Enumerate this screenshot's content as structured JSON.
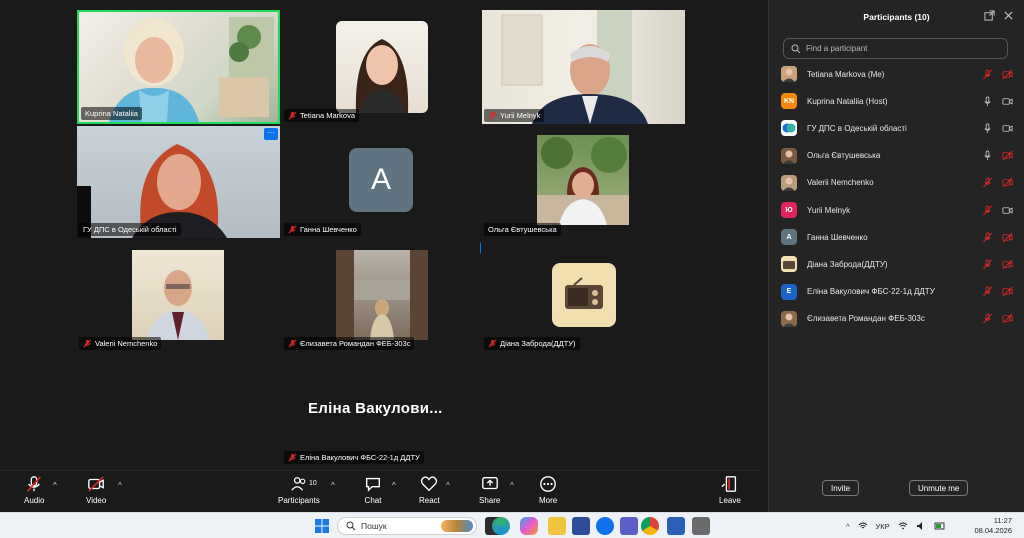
{
  "gallery": {
    "tiles": [
      {
        "name": "Kuprina Nataliia",
        "mic_muted": false
      },
      {
        "name": "Tetiana Markova",
        "mic_muted": true
      },
      {
        "name": "Yurii Melnyk",
        "mic_muted": true
      },
      {
        "name": "ГУ ДПС в Одеській області",
        "mic_muted": false
      },
      {
        "name": "Ганна Шевченко",
        "mic_muted": true,
        "initial": "A"
      },
      {
        "name": "Ольга Євтушевська",
        "mic_muted": false
      },
      {
        "name": "Valerii Nemchenko",
        "mic_muted": true
      },
      {
        "name": "Єлизавета Романдан ФЕБ-303с",
        "mic_muted": true
      },
      {
        "name": "Діана Заброда(ДДТУ)",
        "mic_muted": true
      }
    ],
    "active_speaker_display": "Еліна  Вакулови...",
    "active_speaker_tag": "Еліна Вакулович  ФБС-22-1д ДДТУ",
    "more_label": "···"
  },
  "toolbar": {
    "audio": "Audio",
    "video": "Video",
    "participants": "Participants",
    "participants_count": "10",
    "chat": "Chat",
    "react": "React",
    "share": "Share",
    "more": "More",
    "leave": "Leave"
  },
  "panel": {
    "title": "Participants (10)",
    "search_placeholder": "Find a participant",
    "participants": [
      {
        "name": "Tetiana Markova (Me)",
        "avatar": "photo",
        "color": "#c9a27c",
        "mic": "muted",
        "video": "off"
      },
      {
        "name": "Kuprina Nataliia (Host)",
        "avatar": "KN",
        "color": "#f5870a",
        "mic": "on",
        "video": "on"
      },
      {
        "name": "ГУ ДПС в Одеській області",
        "avatar": "logo",
        "color": "#1d6fd8",
        "mic": "on",
        "video": "on"
      },
      {
        "name": "Ольга Євтушевська",
        "avatar": "photo",
        "color": "#7a5a3e",
        "mic": "on",
        "video": "off"
      },
      {
        "name": "Valerii Nemchenko",
        "avatar": "photo",
        "color": "#b99c7c",
        "mic": "muted",
        "video": "off"
      },
      {
        "name": "Yurii Melnyk",
        "avatar": "Ю",
        "color": "#e0245e",
        "mic": "muted",
        "video": "on"
      },
      {
        "name": "Ганна Шевченко",
        "avatar": "A",
        "color": "#5f7480",
        "mic": "muted",
        "video": "off"
      },
      {
        "name": "Діана Заброда(ДДТУ)",
        "avatar": "radio",
        "color": "#f1dfb0",
        "mic": "muted",
        "video": "off"
      },
      {
        "name": "Еліна Вакулович  ФБС-22-1д ДДТУ",
        "avatar": "E",
        "color": "#1a63c7",
        "mic": "muted",
        "video": "off"
      },
      {
        "name": "Єлизавета Романдан ФЕБ-303с",
        "avatar": "photo",
        "color": "#8b6a4b",
        "mic": "muted",
        "video": "off"
      }
    ],
    "invite_label": "Invite",
    "unmute_label": "Unmute me"
  },
  "taskbar": {
    "search_text": "Пошук",
    "language": "УКР",
    "time": "11:27",
    "date": "08.04.2026"
  },
  "colors": {
    "background": "#1a1a1a",
    "accent": "#0e72ed",
    "muted_red": "#e02828",
    "speaker_border": "#23d959"
  }
}
